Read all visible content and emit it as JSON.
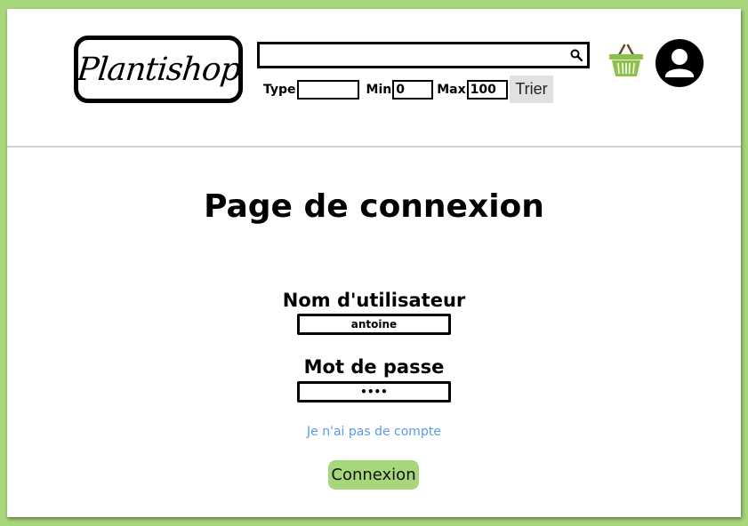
{
  "header": {
    "logo_text": "Plantishop",
    "search": {
      "value": "",
      "placeholder": ""
    },
    "filters": {
      "type_label": "Type",
      "type_value": "",
      "min_label": "Min",
      "min_value": "0",
      "max_label": "Max",
      "max_value": "100",
      "sort_label": "Trier"
    },
    "icons": {
      "search": "search-icon",
      "cart": "basket-icon",
      "account": "account-icon"
    }
  },
  "main": {
    "title": "Page de connexion",
    "username": {
      "label": "Nom d'utilisateur",
      "value": "antoine"
    },
    "password": {
      "label": "Mot de passe",
      "value": "••••"
    },
    "no_account_link": "Je n'ai pas de compte",
    "login_label": "Connexion"
  },
  "colors": {
    "background": "#a8d67a",
    "button_accent": "#a8d67a",
    "link": "#5b9be6",
    "sort_button": "#e1e1e1"
  }
}
